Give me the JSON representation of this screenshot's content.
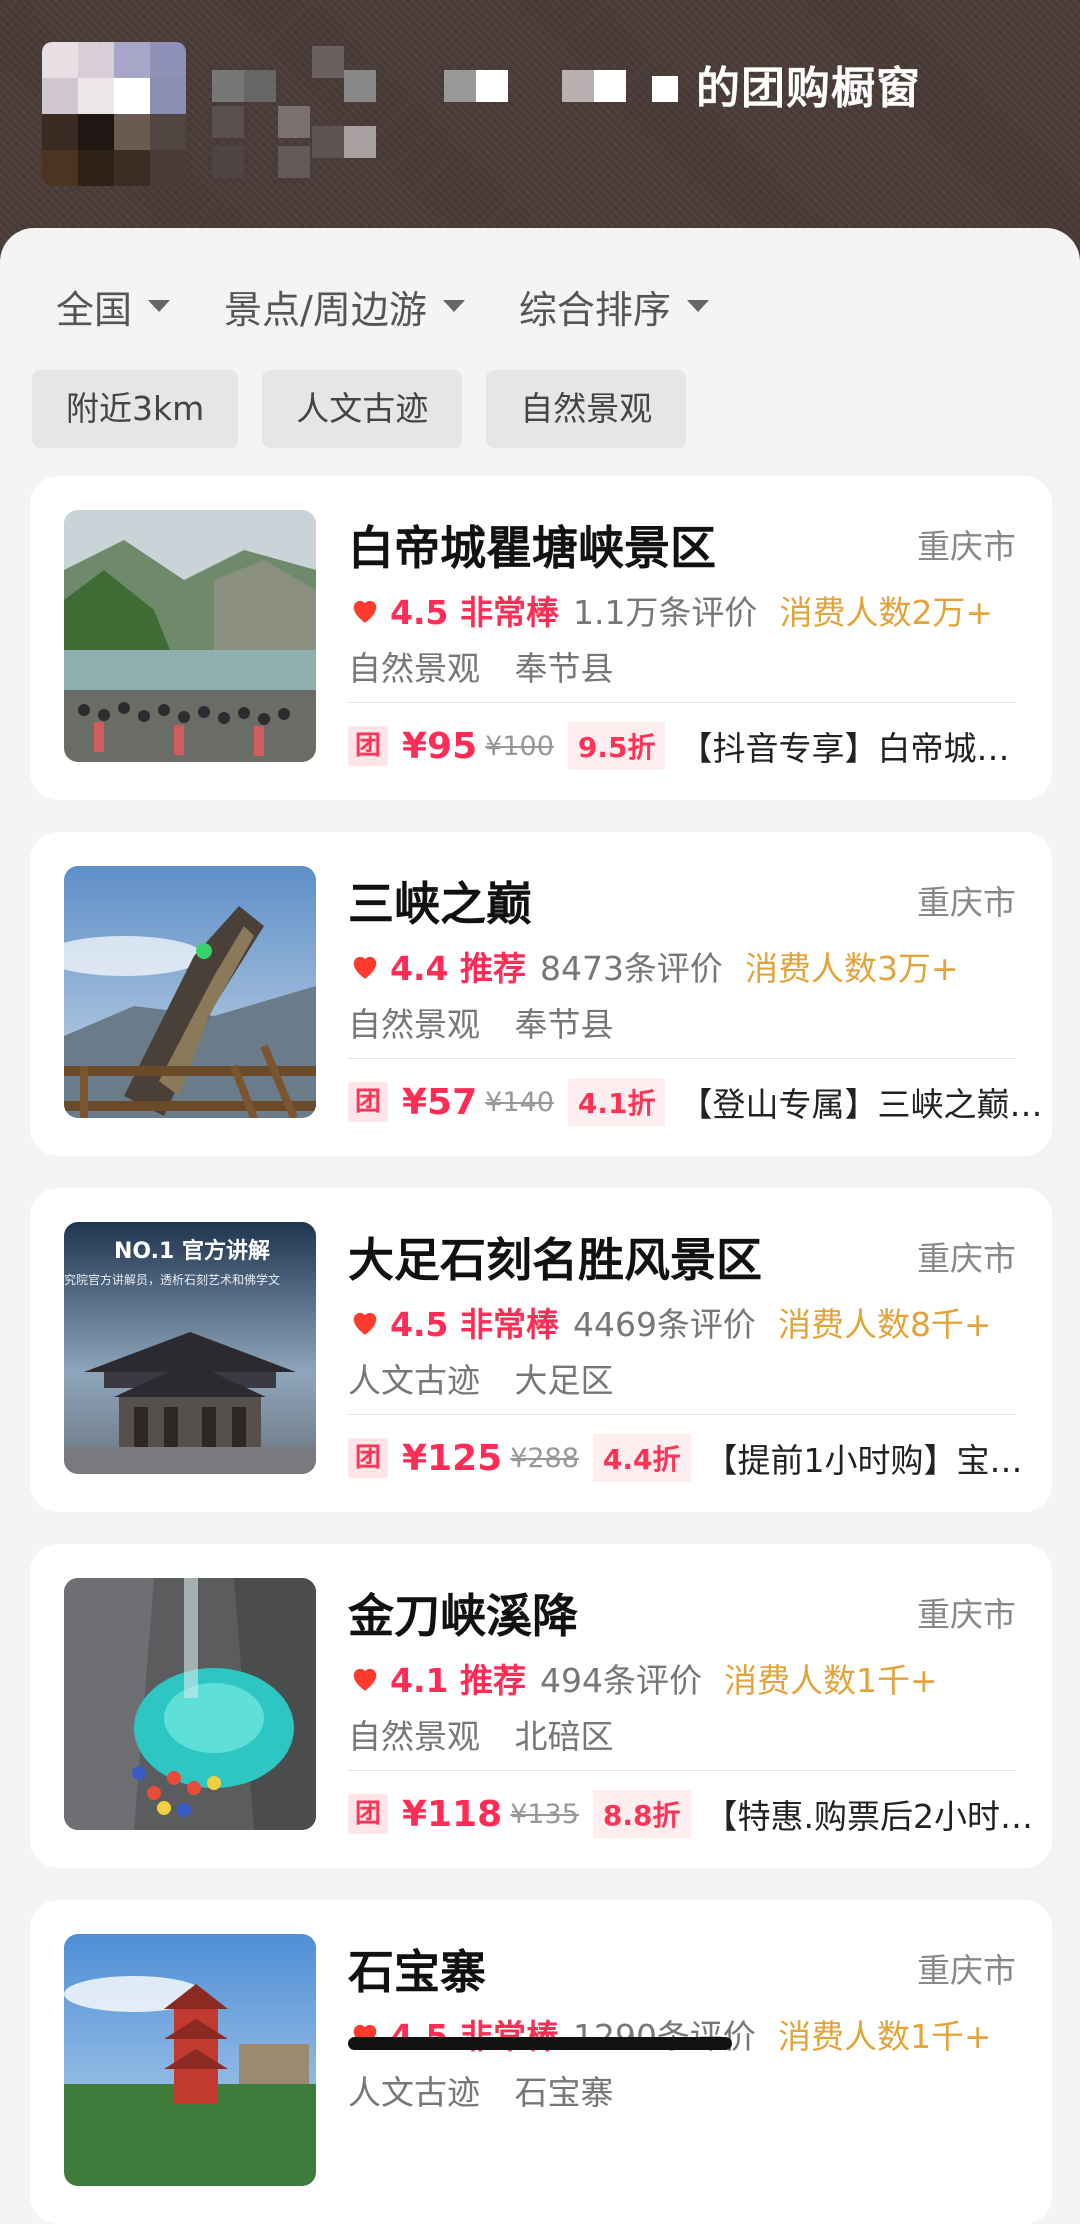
{
  "header": {
    "title": "的团购橱窗"
  },
  "filters": [
    {
      "label": "全国"
    },
    {
      "label": "景点/周边游"
    },
    {
      "label": "综合排序"
    }
  ],
  "tags": [
    {
      "label": "附近3km"
    },
    {
      "label": "人文古迹"
    },
    {
      "label": "自然景观"
    }
  ],
  "listings": [
    {
      "title": "白帝城瞿塘峡景区",
      "city": "重庆市",
      "score": "4.5 非常棒",
      "reviews": "1.1万条评价",
      "customers": "消费人数2万+",
      "category": "自然景观",
      "district": "奉节县",
      "tuan": "团",
      "price": "¥95",
      "original_price": "¥100",
      "discount": "9.5折",
      "deal": "【抖音专享】白帝城…"
    },
    {
      "title": "三峡之巅",
      "city": "重庆市",
      "score": "4.4 推荐",
      "reviews": "8473条评价",
      "customers": "消费人数3万+",
      "category": "自然景观",
      "district": "奉节县",
      "tuan": "团",
      "price": "¥57",
      "original_price": "¥140",
      "discount": "4.1折",
      "deal": "【登山专属】三峡之巅…"
    },
    {
      "title": "大足石刻名胜风景区",
      "city": "重庆市",
      "score": "4.5 非常棒",
      "reviews": "4469条评价",
      "customers": "消费人数8千+",
      "category": "人文古迹",
      "district": "大足区",
      "tuan": "团",
      "price": "¥125",
      "original_price": "¥288",
      "discount": "4.4折",
      "deal": "【提前1小时购】宝…",
      "thumb_text": {
        "title": "NO.1 官方讲解",
        "subtitle": "究院官方讲解员，透析石刻艺术和佛学文"
      }
    },
    {
      "title": "金刀峡溪降",
      "city": "重庆市",
      "score": "4.1 推荐",
      "reviews": "494条评价",
      "customers": "消费人数1千+",
      "category": "自然景观",
      "district": "北碚区",
      "tuan": "团",
      "price": "¥118",
      "original_price": "¥135",
      "discount": "8.8折",
      "deal": "【特惠.购票后2小时…"
    },
    {
      "title": "石宝寨",
      "city": "重庆市",
      "score": "4.5 非常棒",
      "reviews": "1290条评价",
      "customers": "消费人数1千+",
      "category": "人文古迹",
      "district": "石宝寨"
    }
  ],
  "colors": {
    "accent": "#ff2d55",
    "gold": "#e3a43a",
    "header_bg": "#4a3b38"
  }
}
